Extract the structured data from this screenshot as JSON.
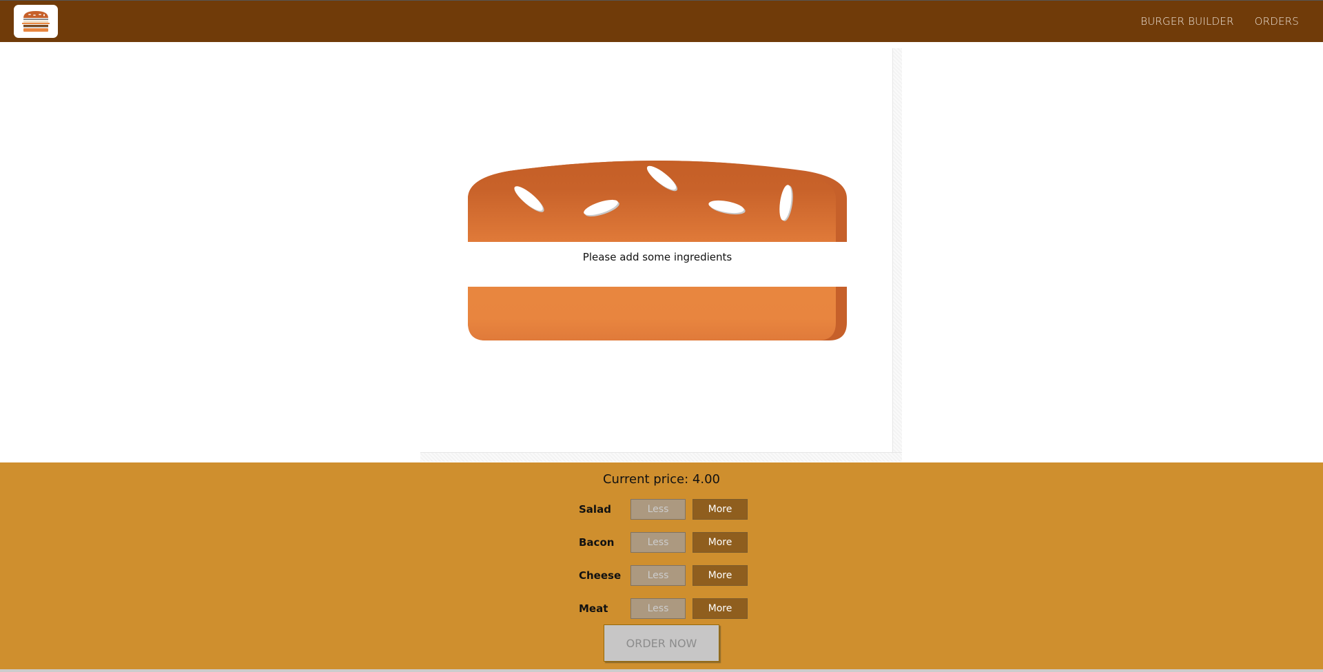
{
  "app": {
    "logo_icon": "burger-logo-icon"
  },
  "nav": {
    "items": [
      {
        "label": "BURGER BUILDER",
        "active": true
      },
      {
        "label": "ORDERS",
        "active": false
      }
    ]
  },
  "burger": {
    "empty_message": "Please add some ingredients",
    "colors": {
      "bun_top": "#C6602A",
      "bun_bottom": "#E8863F",
      "seed": "#FFFFFF"
    }
  },
  "build_controls": {
    "price_label": "Current price:",
    "price": "4.00",
    "less_label": "Less",
    "more_label": "More",
    "ingredients": [
      {
        "label": "Salad",
        "less_disabled": true
      },
      {
        "label": "Bacon",
        "less_disabled": true
      },
      {
        "label": "Cheese",
        "less_disabled": true
      },
      {
        "label": "Meat",
        "less_disabled": true
      }
    ],
    "order_label": "ORDER NOW",
    "order_disabled": true,
    "colors": {
      "background": "#CF8F2E",
      "more_button": "#8F5E1E",
      "less_button": "#AC9980"
    }
  },
  "theme": {
    "toolbar": "#703B09"
  }
}
